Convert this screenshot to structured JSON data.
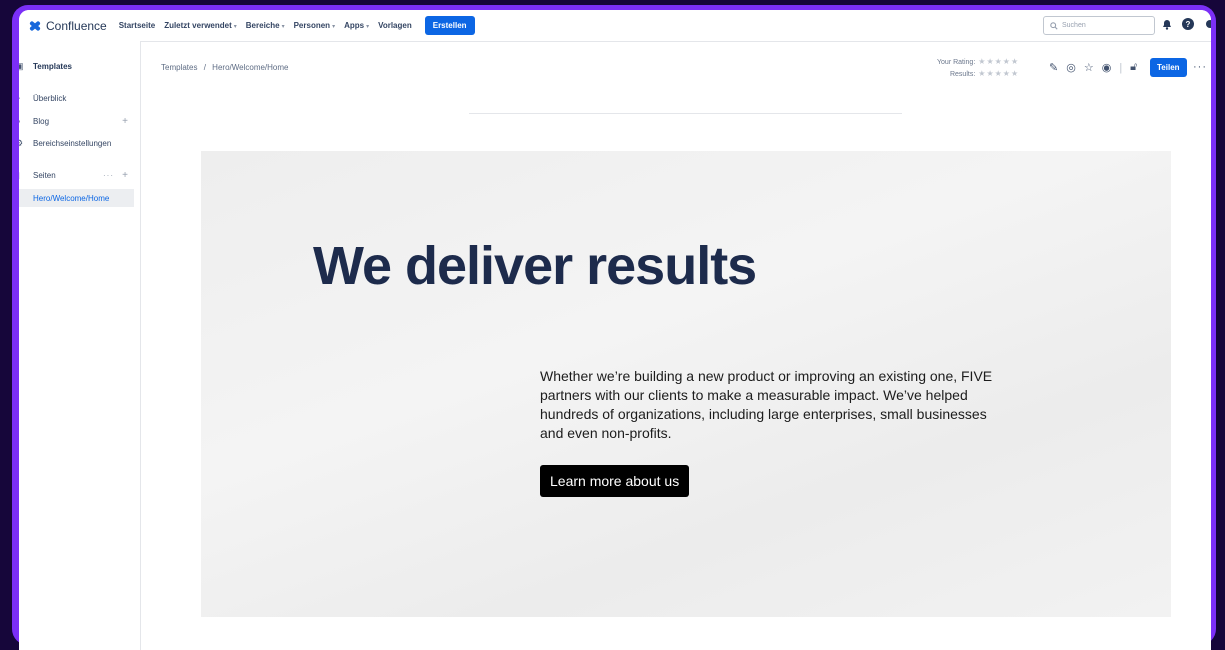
{
  "app": {
    "name": "Confluence"
  },
  "topnav": {
    "items": [
      {
        "label": "Startseite",
        "dropdown": false
      },
      {
        "label": "Zuletzt verwendet",
        "dropdown": true
      },
      {
        "label": "Bereiche",
        "dropdown": true
      },
      {
        "label": "Personen",
        "dropdown": true
      },
      {
        "label": "Apps",
        "dropdown": true
      },
      {
        "label": "Vorlagen",
        "dropdown": false
      }
    ],
    "create_label": "Erstellen",
    "search_placeholder": "Suchen"
  },
  "sidebar": {
    "space_title": "Templates",
    "items": [
      {
        "label": "Überblick"
      },
      {
        "label": "Blog"
      },
      {
        "label": "Bereichseinstellungen"
      }
    ],
    "pages_label": "Seiten",
    "tree": [
      {
        "label": "Hero/Welcome/Home",
        "active": true
      }
    ]
  },
  "breadcrumb": {
    "root": "Templates",
    "separator": "/",
    "current": "Hero/Welcome/Home"
  },
  "rating": {
    "your_label": "Your Rating:",
    "results_label": "Results:",
    "stars": "★★★★★"
  },
  "actions": {
    "share_label": "Teilen"
  },
  "hero": {
    "title": "We deliver results",
    "text": "Whether we’re building a new product or improving an existing one, FIVE partners with our clients to make a measurable impact. We’ve helped hundreds of organizations, including large enterprises, small businesses and even non-profits.",
    "button_label": "Learn more about us"
  },
  "colors": {
    "accent": "#0c66e4",
    "frame": "#7b2ff7",
    "hero_title": "#1d2b4c"
  }
}
